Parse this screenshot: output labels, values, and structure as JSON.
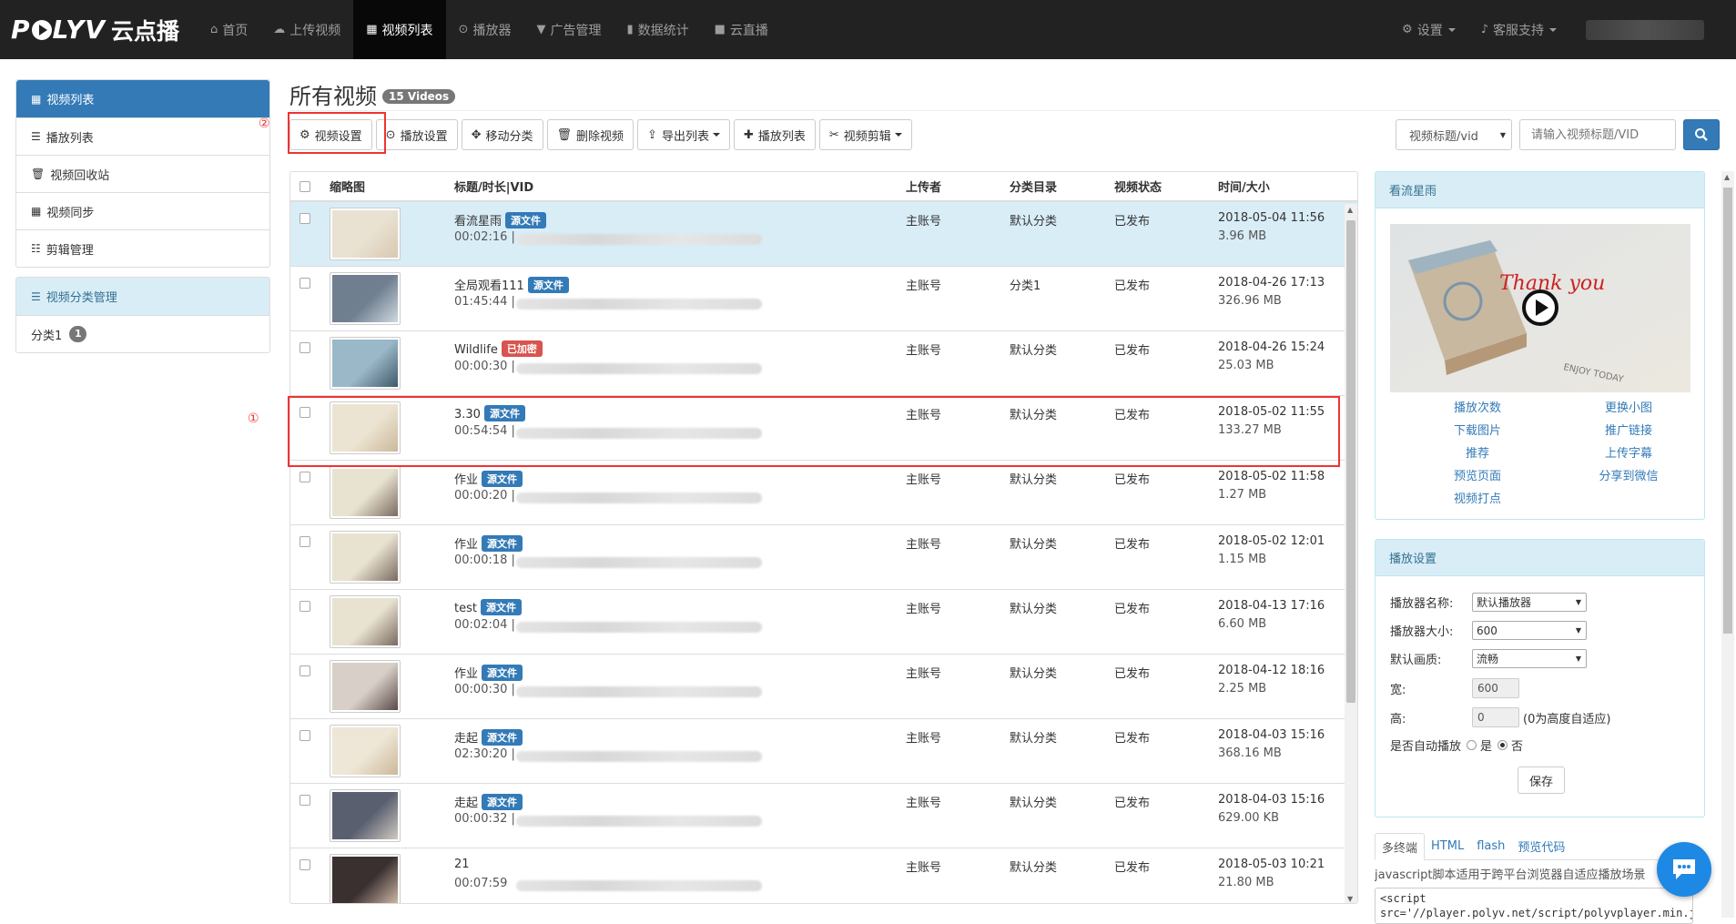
{
  "nav": {
    "logo_text": "POLYV",
    "logo_cn": "云点播",
    "items": [
      {
        "label": "首页",
        "icon": "home-icon"
      },
      {
        "label": "上传视频",
        "icon": "upload-icon"
      },
      {
        "label": "视频列表",
        "icon": "film-icon",
        "active": true
      },
      {
        "label": "播放器",
        "icon": "play-circle-icon"
      },
      {
        "label": "广告管理",
        "icon": "filter-icon"
      },
      {
        "label": "数据统计",
        "icon": "bar-chart-icon"
      },
      {
        "label": "云直播",
        "icon": "video-camera-icon"
      }
    ],
    "settings": "设置",
    "support": "客服支持"
  },
  "sidebar": {
    "group1": [
      {
        "label": "视频列表",
        "icon": "film-icon"
      },
      {
        "label": "播放列表",
        "icon": "th-list-icon"
      },
      {
        "label": "视频回收站",
        "icon": "trash-icon"
      },
      {
        "label": "视频同步",
        "icon": "film-icon"
      },
      {
        "label": "剪辑管理",
        "icon": "tasks-icon"
      }
    ],
    "group2_head": "视频分类管理",
    "category": {
      "label": "分类1",
      "count": "1"
    }
  },
  "markers": {
    "m1": "①",
    "m2": "②"
  },
  "page": {
    "title": "所有视频",
    "count_badge": "15 Videos"
  },
  "toolbar": {
    "video_settings": "视频设置",
    "play_settings": "播放设置",
    "move_category": "移动分类",
    "delete_video": "删除视频",
    "export_list": "导出列表",
    "playlist": "播放列表",
    "video_edit": "视频剪辑"
  },
  "search": {
    "select_value": "视频标题/vid",
    "placeholder": "请输入视频标题/VID"
  },
  "table": {
    "headers": {
      "thumb": "缩略图",
      "title": "标题/时长|VID",
      "uploader": "上传者",
      "category": "分类目录",
      "status": "视频状态",
      "time": "时间/大小"
    },
    "rows": [
      {
        "title": "看流星雨",
        "tag": "源文件",
        "tag_color": "#337ab7",
        "duration": "00:02:16 |",
        "uploader": "主账号",
        "category": "默认分类",
        "status": "已发布",
        "time": "2018-05-04 11:56",
        "size": "3.96 MB"
      },
      {
        "title": "全局观看111",
        "tag": "源文件",
        "tag_color": "#337ab7",
        "duration": "01:45:44 |",
        "uploader": "主账号",
        "category": "分类1",
        "status": "已发布",
        "time": "2018-04-26 17:13",
        "size": "326.96 MB"
      },
      {
        "title": "Wildlife",
        "tag": "已加密",
        "tag_color": "#d9534f",
        "duration": "00:00:30 |",
        "uploader": "主账号",
        "category": "默认分类",
        "status": "已发布",
        "time": "2018-04-26 15:24",
        "size": "25.03 MB"
      },
      {
        "title": "3.30",
        "tag": "源文件",
        "tag_color": "#337ab7",
        "duration": "00:54:54 |",
        "uploader": "主账号",
        "category": "默认分类",
        "status": "已发布",
        "time": "2018-05-02 11:55",
        "size": "133.27 MB"
      },
      {
        "title": "作业",
        "tag": "源文件",
        "tag_color": "#337ab7",
        "duration": "00:00:20 |",
        "uploader": "主账号",
        "category": "默认分类",
        "status": "已发布",
        "time": "2018-05-02 11:58",
        "size": "1.27 MB"
      },
      {
        "title": "作业",
        "tag": "源文件",
        "tag_color": "#337ab7",
        "duration": "00:00:18 |",
        "uploader": "主账号",
        "category": "默认分类",
        "status": "已发布",
        "time": "2018-05-02 12:01",
        "size": "1.15 MB"
      },
      {
        "title": "test",
        "tag": "源文件",
        "tag_color": "#337ab7",
        "duration": "00:02:04 |",
        "uploader": "主账号",
        "category": "默认分类",
        "status": "已发布",
        "time": "2018-04-13 17:16",
        "size": "6.60 MB"
      },
      {
        "title": "作业",
        "tag": "源文件",
        "tag_color": "#337ab7",
        "duration": "00:00:30 |",
        "uploader": "主账号",
        "category": "默认分类",
        "status": "已发布",
        "time": "2018-04-12 18:16",
        "size": "2.25 MB"
      },
      {
        "title": "走起",
        "tag": "源文件",
        "tag_color": "#337ab7",
        "duration": "02:30:20 |",
        "uploader": "主账号",
        "category": "默认分类",
        "status": "已发布",
        "time": "2018-04-03 15:16",
        "size": "368.16 MB"
      },
      {
        "title": "走起",
        "tag": "源文件",
        "tag_color": "#337ab7",
        "duration": "00:00:32 |",
        "uploader": "主账号",
        "category": "默认分类",
        "status": "已发布",
        "time": "2018-04-03 15:16",
        "size": "629.00 KB"
      },
      {
        "title": "21",
        "tag": "",
        "tag_color": "#337ab7",
        "duration": "00:07:59",
        "uploader": "主账号",
        "category": "默认分类",
        "status": "已发布",
        "time": "2018-05-03 10:21",
        "size": "21.80 MB"
      }
    ]
  },
  "preview_panel": {
    "title": "看流星雨",
    "links_left": [
      "播放次数",
      "下载图片",
      "推荐",
      "预览页面",
      "视频打点"
    ],
    "links_right": [
      "更换小图",
      "推广链接",
      "上传字幕",
      "分享到微信"
    ]
  },
  "player_panel": {
    "title": "播放设置",
    "name_label": "播放器名称:",
    "name_value": "默认播放器",
    "size_label": "播放器大小:",
    "size_value": "600",
    "quality_label": "默认画质:",
    "quality_value": "流畅",
    "width_label": "宽:",
    "width_value": "600",
    "height_label": "高:",
    "height_value": "0",
    "height_hint": "(0为高度自适应)",
    "autoplay_label": "是否自动播放",
    "yes": "是",
    "no": "否",
    "save": "保存"
  },
  "code_tabs": {
    "tabs": [
      "多终端",
      "HTML",
      "flash",
      "预览代码"
    ],
    "desc": "javascript脚本适用于跨平台浏览器自适应播放场景",
    "code_line1": "<script",
    "code_line2": "src='//player.polyv.net/script/polyvplayer.min.js'>"
  }
}
